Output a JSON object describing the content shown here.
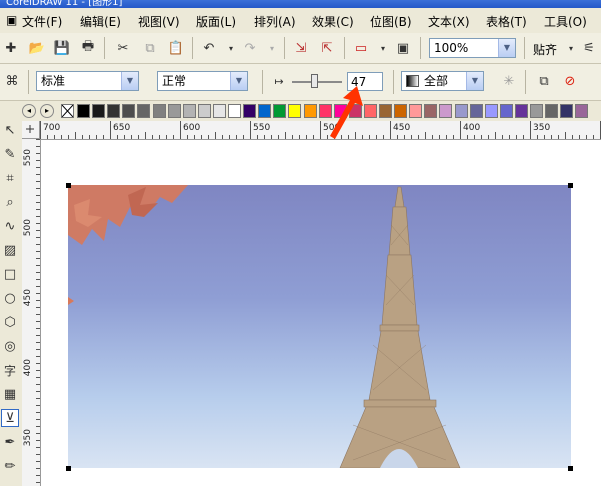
{
  "window": {
    "title": "CorelDRAW 11 - [图形1]"
  },
  "menu": [
    "文件(F)",
    "编辑(E)",
    "视图(V)",
    "版面(L)",
    "排列(A)",
    "效果(C)",
    "位图(B)",
    "文本(X)",
    "表格(T)",
    "工具(O)"
  ],
  "toolbar": {
    "zoom_value": "100%",
    "snap_label": "贴齐"
  },
  "property_bar": {
    "transparency_type": "标准",
    "merge_mode": "正常",
    "opacity_value": "47",
    "apply_to": "全部"
  },
  "palette_colors": [
    "#000000",
    "#1a1a1a",
    "#333333",
    "#4d4d4d",
    "#666666",
    "#808080",
    "#999999",
    "#b3b3b3",
    "#cccccc",
    "#e6e6e6",
    "#ffffff",
    "#330066",
    "#0066cc",
    "#009933",
    "#ffff00",
    "#ff9900",
    "#ff3366",
    "#ff0099",
    "#cc3366",
    "#ff6666",
    "#996633",
    "#cc6600",
    "#ff9999",
    "#996666",
    "#cc99cc",
    "#9999cc",
    "#666699",
    "#9999ff",
    "#6666cc",
    "#663399",
    "#999999",
    "#666666",
    "#333366",
    "#996699",
    "#ffcc00"
  ],
  "hruler_labels": [
    "700",
    "650",
    "600",
    "550",
    "500",
    "450",
    "400",
    "350"
  ],
  "vruler_labels": [
    "550",
    "500",
    "450",
    "400",
    "350"
  ],
  "accent": {
    "arrow": "#ff3300",
    "selection_handle": "#000000"
  },
  "icons": [
    "pick-tool-icon",
    "shape-tool-icon",
    "crop-tool-icon",
    "zoom-tool-icon",
    "freehand-tool-icon",
    "smart-fill-icon",
    "rectangle-tool-icon",
    "ellipse-tool-icon",
    "polygon-tool-icon",
    "spiral-tool-icon",
    "text-tool-icon",
    "table-tool-icon",
    "transparency-tool-icon",
    "eyedropper-tool-icon"
  ]
}
